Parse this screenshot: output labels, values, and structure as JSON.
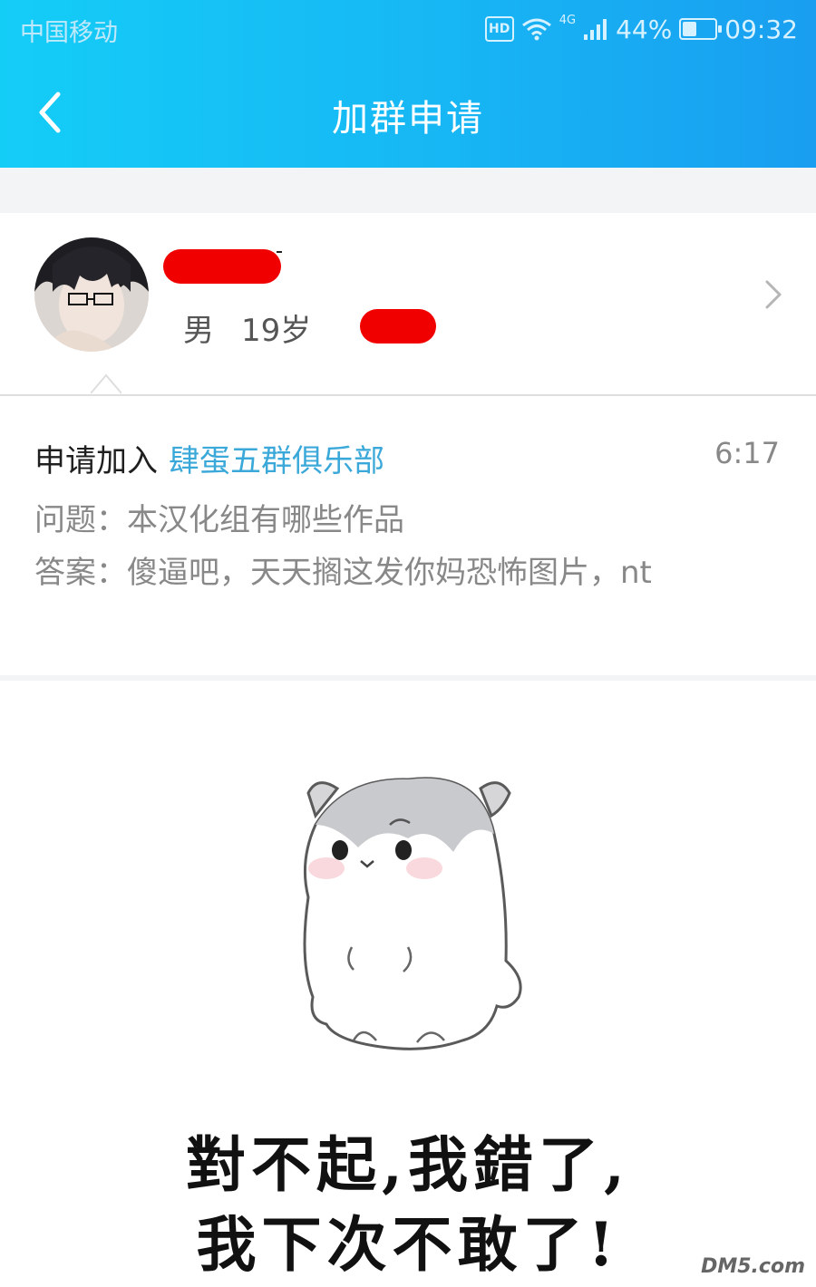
{
  "status_bar": {
    "carrier": "中国移动",
    "hd": "HD",
    "network": "4G",
    "battery": "44%",
    "battery_level": 0.44,
    "time": "09:32"
  },
  "nav": {
    "back_icon": "chevron-left-icon",
    "title": "加群申请"
  },
  "user": {
    "gender": "男",
    "age": "19岁",
    "name_redacted": true
  },
  "request": {
    "label": "申请加入",
    "group_name": "肆蛋五群俱乐部",
    "time": "6:17",
    "question": "问题：本汉化组有哪些作品",
    "answer": "答案：傻逼吧，天天搁这发你妈恐怖图片，nt"
  },
  "sticker": {
    "line1": "對不起,我錯了,",
    "line2": "我下次不敢了!"
  },
  "watermark": "DM5.com",
  "colors": {
    "header_start": "#14cdf7",
    "header_end": "#199ef0",
    "group_link": "#3aa8d8",
    "redaction": "#f10000"
  }
}
